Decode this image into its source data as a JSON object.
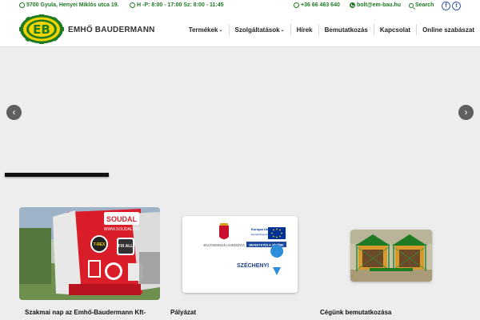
{
  "topbar": {
    "address": "5700 Gyula, Henyei Miklós utca 19.",
    "hours": "H -P: 8:00 - 17:00 Sz: 8:00 - 11:45",
    "phone": "+36 66 463 640",
    "email": "bolt@em-bau.hu",
    "search": "Search",
    "social": [
      "facebook-icon",
      "twitter-icon"
    ]
  },
  "header": {
    "logo_text": "EMHŐ BAUDERMANN",
    "nav": [
      {
        "label": "Termékek",
        "has_dropdown": true
      },
      {
        "label": "Szolgáltatások",
        "has_dropdown": true
      },
      {
        "label": "Hírek",
        "has_dropdown": false
      },
      {
        "label": "Bemutatkozás",
        "has_dropdown": false
      },
      {
        "label": "Kapcsolat",
        "has_dropdown": false
      },
      {
        "label": "Online szabászat",
        "has_dropdown": false
      }
    ]
  },
  "slider": {
    "prev_icon": "chevron-left-icon",
    "next_icon": "chevron-right-icon"
  },
  "cards": [
    {
      "title": "Szakmai nap az Emhő-Baudermann Kft-",
      "image_text": [
        "SOUDAL",
        "WWW.SOUDAL.HU",
        "T-REX",
        "FIX ALL"
      ]
    },
    {
      "title": "Pályázat",
      "image_text": [
        "Európai Unió",
        "Európai Regionális Fejlesztési Alap",
        "MAGYARORSZÁG KORMÁNYA",
        "BEFEKTETÉS A JÖVŐBE",
        "SZÉCHENYI",
        "2020"
      ]
    },
    {
      "title": "Cégünk bemutatkozása",
      "image_text": []
    }
  ],
  "colors": {
    "brand_green": "#1f7a24",
    "logo_yellow": "#f2d400",
    "soudal_red": "#d91e2a"
  }
}
